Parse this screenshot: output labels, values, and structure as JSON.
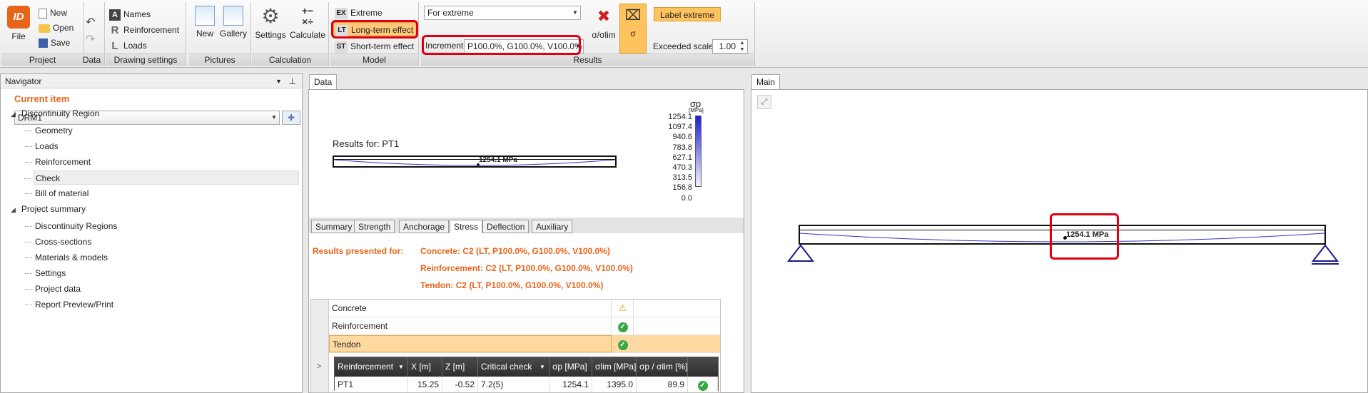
{
  "ribbon": {
    "project": {
      "file": "File",
      "new": "New",
      "open": "Open",
      "save": "Save",
      "group": "Project"
    },
    "data": {
      "group": "Data"
    },
    "drawing": {
      "names": "Names",
      "reinforcement": "Reinforcement",
      "loads": "Loads",
      "group": "Drawing settings",
      "names_letter": "A",
      "reinf_letter": "R",
      "loads_letter": "L"
    },
    "pictures": {
      "new": "New",
      "gallery": "Gallery",
      "group": "Pictures"
    },
    "calculation": {
      "settings": "Settings",
      "calculate": "Calculate",
      "group": "Calculation"
    },
    "model": {
      "extreme": "Extreme",
      "longterm": "Long-term effect",
      "shortterm": "Short-term effect",
      "group": "Model",
      "ex_tag": "EX",
      "lt_tag": "LT",
      "st_tag": "ST"
    },
    "results": {
      "for_extreme": "For extreme",
      "increment_label": "Increment",
      "increment_value": "P100.0%, G100.0%, V100.0%",
      "sigma_olim": "σ/σlim",
      "sigma": "σ",
      "label_extreme": "Label extreme",
      "exceeded_scale_label": "Exceeded scale",
      "exceeded_scale_value": "1.00",
      "group": "Results"
    }
  },
  "navigator": {
    "title": "Navigator",
    "current_item": "Current item",
    "item_select": "DRM1",
    "tree": [
      {
        "label": "Discontinuity Region",
        "level": 0
      },
      {
        "label": "Geometry",
        "level": 1
      },
      {
        "label": "Loads",
        "level": 1
      },
      {
        "label": "Reinforcement",
        "level": 1
      },
      {
        "label": "Check",
        "level": 1,
        "selected": true
      },
      {
        "label": "Bill of material",
        "level": 1
      },
      {
        "label": "Project summary",
        "level": 0
      },
      {
        "label": "Discontinuity Regions",
        "level": 1
      },
      {
        "label": "Cross-sections",
        "level": 1
      },
      {
        "label": "Materials & models",
        "level": 1
      },
      {
        "label": "Settings",
        "level": 1
      },
      {
        "label": "Project data",
        "level": 1
      },
      {
        "label": "Report Preview/Print",
        "level": 1
      }
    ]
  },
  "data_panel": {
    "tab": "Data",
    "results_for": "Results for: PT1",
    "beam_value": "1254.1 MPa",
    "legend": {
      "title": "σp",
      "unit": "[MPa]",
      "values": [
        "1254.1",
        "1097.4",
        "940.6",
        "783.8",
        "627.1",
        "470.3",
        "313.5",
        "156.8",
        "0.0"
      ]
    },
    "subtabs": [
      "Summary",
      "Strength",
      "Anchorage",
      "Stress",
      "Deflection",
      "Auxiliary"
    ],
    "active_subtab": "Stress",
    "presented_label": "Results presented for:",
    "presented": [
      "Concrete: C2 (LT, P100.0%, G100.0%, V100.0%)",
      "Reinforcement: C2 (LT, P100.0%, G100.0%, V100.0%)",
      "Tendon: C2 (LT, P100.0%, G100.0%, V100.0%)"
    ],
    "checks": [
      {
        "name": "Concrete",
        "status": "warning"
      },
      {
        "name": "Reinforcement",
        "status": "ok"
      },
      {
        "name": "Tendon",
        "status": "ok",
        "selected": true
      }
    ],
    "table": {
      "headers": [
        "Reinforcement",
        "X [m]",
        "Z [m]",
        "Critical check",
        "σp [MPa]",
        "σlim [MPa]",
        "σp / σlim [%]"
      ],
      "rows": [
        [
          "PT1",
          "15.25",
          "-0.52",
          "7.2(5)",
          "1254.1",
          "1395.0",
          "89.9"
        ]
      ]
    }
  },
  "main_panel": {
    "tab": "Main",
    "beam_value": "1254.1 MPa"
  },
  "colors": {
    "accent": "#e8641b",
    "highlight": "#ffd28a",
    "red": "#e0000f",
    "gradient_top": "#1f1fd6",
    "grid_header": "#3c3c3c"
  }
}
